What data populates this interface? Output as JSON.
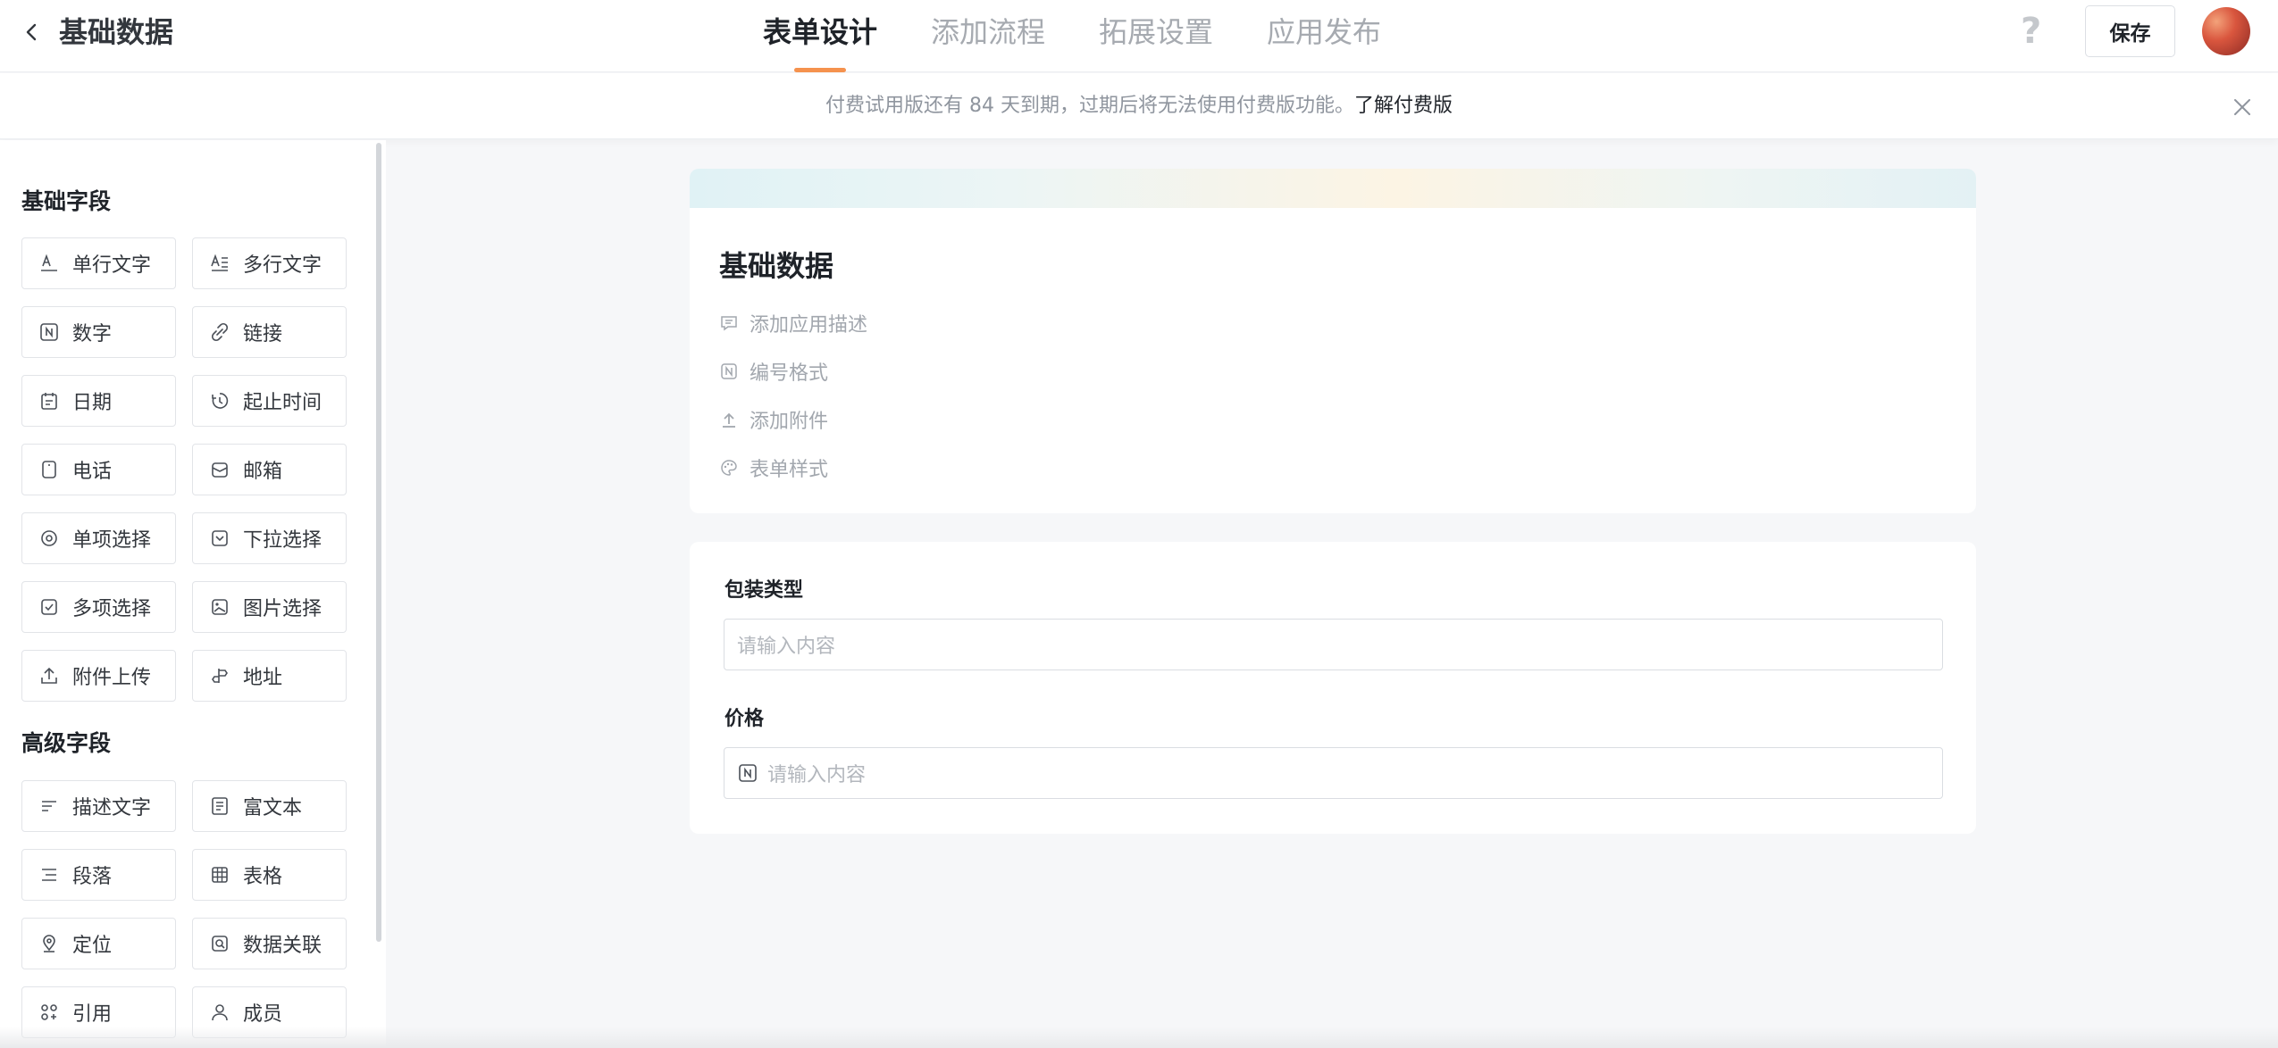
{
  "header": {
    "title": "基础数据",
    "tabs": [
      {
        "label": "表单设计",
        "active": true
      },
      {
        "label": "添加流程",
        "active": false
      },
      {
        "label": "拓展设置",
        "active": false
      },
      {
        "label": "应用发布",
        "active": false
      }
    ],
    "help_label": "?",
    "save_label": "保存"
  },
  "notice": {
    "text": "付费试用版还有 84 天到期，过期后将无法使用付费版功能。",
    "link": "了解付费版"
  },
  "sidebar": {
    "basic_title": "基础字段",
    "basic_fields": [
      {
        "label": "单行文字",
        "icon": "single-line-text-icon"
      },
      {
        "label": "多行文字",
        "icon": "multi-line-text-icon"
      },
      {
        "label": "数字",
        "icon": "number-icon"
      },
      {
        "label": "链接",
        "icon": "link-icon"
      },
      {
        "label": "日期",
        "icon": "calendar-icon"
      },
      {
        "label": "起止时间",
        "icon": "time-range-icon"
      },
      {
        "label": "电话",
        "icon": "phone-icon"
      },
      {
        "label": "邮箱",
        "icon": "mail-icon"
      },
      {
        "label": "单项选择",
        "icon": "radio-icon"
      },
      {
        "label": "下拉选择",
        "icon": "dropdown-icon"
      },
      {
        "label": "多项选择",
        "icon": "checkbox-icon"
      },
      {
        "label": "图片选择",
        "icon": "image-icon"
      },
      {
        "label": "附件上传",
        "icon": "upload-icon"
      },
      {
        "label": "地址",
        "icon": "address-icon"
      }
    ],
    "advanced_title": "高级字段",
    "advanced_fields": [
      {
        "label": "描述文字",
        "icon": "description-icon"
      },
      {
        "label": "富文本",
        "icon": "rich-text-icon"
      },
      {
        "label": "段落",
        "icon": "paragraph-icon"
      },
      {
        "label": "表格",
        "icon": "table-icon"
      },
      {
        "label": "定位",
        "icon": "location-icon"
      },
      {
        "label": "数据关联",
        "icon": "data-link-icon"
      },
      {
        "label": "引用",
        "icon": "reference-icon"
      },
      {
        "label": "成员",
        "icon": "member-icon"
      }
    ]
  },
  "form": {
    "title": "基础数据",
    "options": [
      {
        "label": "添加应用描述",
        "icon": "comment-icon"
      },
      {
        "label": "编号格式",
        "icon": "number-format-icon"
      },
      {
        "label": "添加附件",
        "icon": "upload-icon"
      },
      {
        "label": "表单样式",
        "icon": "palette-icon"
      }
    ],
    "fields": [
      {
        "label": "包装类型",
        "placeholder": "请输入内容"
      },
      {
        "label": "价格",
        "placeholder": "请输入内容",
        "icon": "number-icon"
      }
    ]
  },
  "colors": {
    "accent": "#f5924e",
    "text": "#1f2329",
    "muted": "#a6aab0"
  }
}
